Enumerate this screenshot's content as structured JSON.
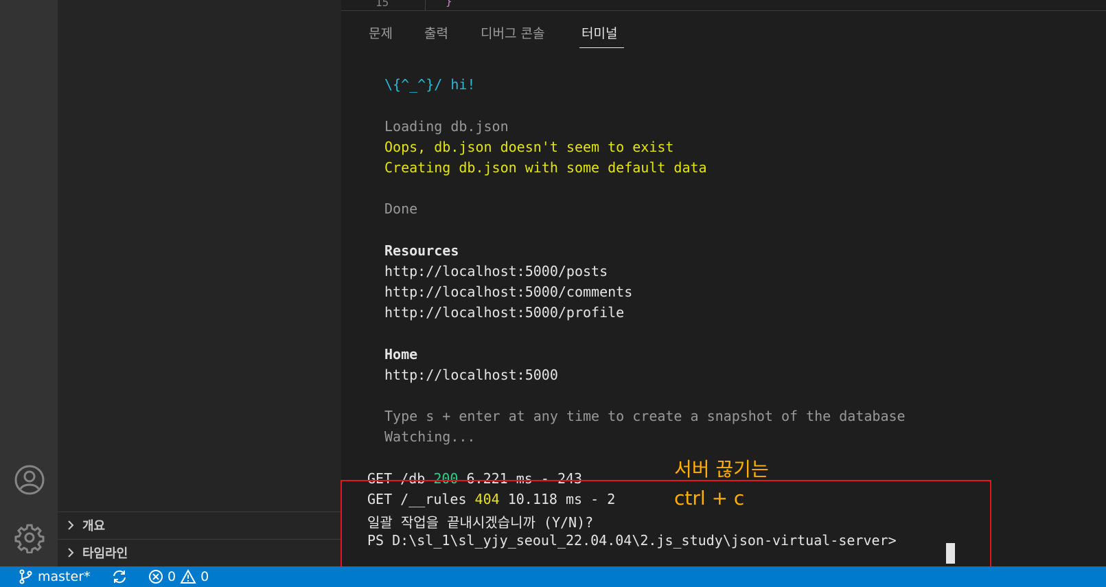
{
  "sidebar": {
    "sections": [
      {
        "label": "개요"
      },
      {
        "label": "타임라인"
      }
    ]
  },
  "editor": {
    "line_number": "15",
    "code_fragment": "}"
  },
  "panel": {
    "tabs": [
      {
        "label": "문제",
        "active": false
      },
      {
        "label": "출력",
        "active": false
      },
      {
        "label": "디버그 콘솔",
        "active": false
      },
      {
        "label": "터미널",
        "active": true
      }
    ]
  },
  "terminal": {
    "banner": "\\{^_^}/ hi!",
    "loading": "Loading db.json",
    "oops": "Oops, db.json doesn't seem to exist",
    "creating": "Creating db.json with some default data",
    "done": "Done",
    "resources_heading": "Resources",
    "resources": [
      "http://localhost:5000/posts",
      "http://localhost:5000/comments",
      "http://localhost:5000/profile"
    ],
    "home_heading": "Home",
    "home_url": "http://localhost:5000",
    "snapshot_hint": "Type s + enter at any time to create a snapshot of the database",
    "watching": "Watching...",
    "requests": [
      {
        "method_path": "GET /db ",
        "status": "200",
        "rest": " 6.221 ms - 243",
        "status_color": "#23d18b"
      },
      {
        "method_path": "GET /__rules ",
        "status": "404",
        "rest": " 10.118 ms - 2",
        "status_color": "#e5e510"
      }
    ],
    "confirm_prompt": "일괄 작업을 끝내시겠습니까 (Y/N)?",
    "ps_prompt": "PS D:\\sl_1\\sl_yjy_seoul_22.04.04\\2.js_study\\json-virtual-server> "
  },
  "annotation": {
    "line1": "서버 끊기는",
    "line2": "ctrl + c",
    "color": "#ffb000",
    "box_color": "#e8141d"
  },
  "statusbar": {
    "branch": "master*",
    "errors": "0",
    "warnings": "0",
    "background": "#007acc"
  }
}
